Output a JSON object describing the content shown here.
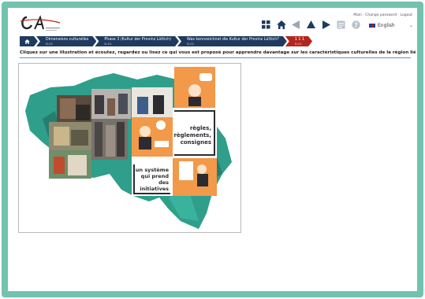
{
  "header": {
    "top_links": "Main · Change password · Logout",
    "language": "English",
    "nav": [
      "menu-icon",
      "home-icon",
      "back-icon",
      "up-icon",
      "forward-icon",
      "notes-icon",
      "help-icon"
    ]
  },
  "breadcrumb": [
    {
      "label": "Dimensions culturelles",
      "sub": "D-01"
    },
    {
      "label": "Phase 3 (Kultur der Provinz Lüttich)",
      "sub": "D-01"
    },
    {
      "label": "Was kennzeichnet die Kultur der Provinz Lüttich?",
      "sub": "D-01"
    },
    {
      "label": "1 1 1",
      "sub": "D-01"
    }
  ],
  "instruction": "Cliquez sur une illustration et écoutez, regardez ou lisez ce qui vous est proposé pour apprendre davantage sur les caractéristiques culturelles de la région liégeoise.",
  "map": {
    "card1_text": [
      "règles,",
      "règlements,",
      "consignes"
    ],
    "card2_text": [
      "un système",
      "qui prend",
      "des",
      "initiatives"
    ]
  },
  "colors": {
    "frame": "#73c2b0",
    "breadcrumb": "#1f3a5f",
    "breadcrumb_active": "#b3261e",
    "map_teal": "#2f9e8a",
    "card_orange": "#f2994a"
  }
}
